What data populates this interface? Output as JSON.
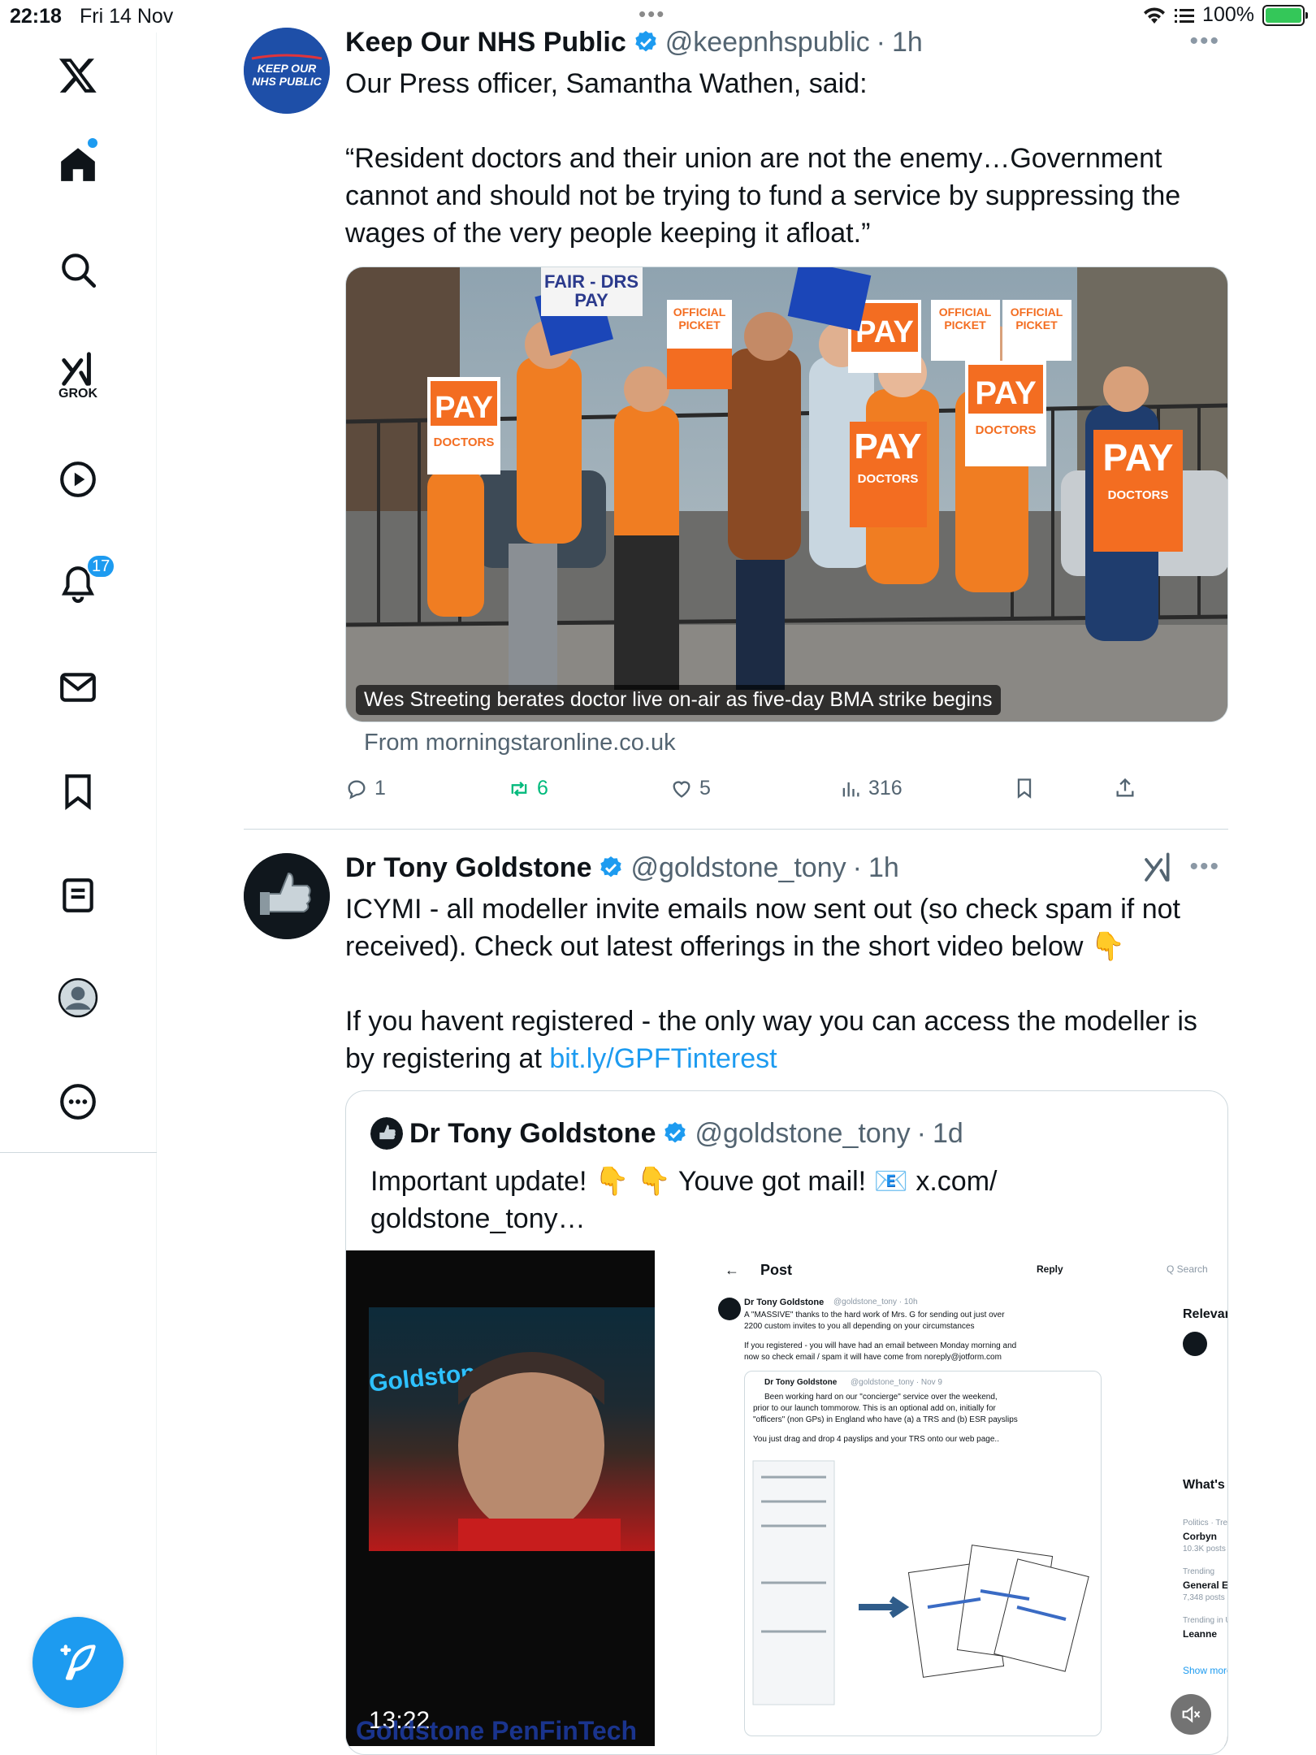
{
  "status_bar": {
    "time": "22:18",
    "date": "Fri 14 Nov",
    "battery": "100%"
  },
  "sidebar": {
    "grok_label": "GROK",
    "notifications_count": "17"
  },
  "posts": [
    {
      "avatar_text": "KEEP OUR NHS PUBLIC",
      "name": "Keep Our NHS Public",
      "handle": "@keepnhspublic",
      "sep": "·",
      "time": "1h",
      "text": "Our Press officer, Samantha Wathen, said:\n\n“Resident doctors and their union are not the enemy…Government cannot and should not be trying to fund a service by suppressing the wages of the very people keeping it afloat.”",
      "link_card": {
        "caption": "Wes Streeting berates doctor live on-air as five-day BMA strike begins",
        "from": "From morningstaronline.co.uk"
      },
      "actions": {
        "replies": "1",
        "reposts": "6",
        "likes": "5",
        "views": "316"
      }
    },
    {
      "name": "Dr Tony Goldstone",
      "handle": "@goldstone_tony",
      "sep": "·",
      "time": "1h",
      "text_part1": "ICYMI - all modeller invite emails now sent out (so check spam if not received). Check out latest offerings in the short video below 👇\n\nIf you havent registered - the only way you can access the modeller is by registering at ",
      "link": "bit.ly/GPFTinterest",
      "quote": {
        "name": "Dr Tony Goldstone",
        "handle": "@goldstone_tony",
        "sep": "·",
        "time": "1d",
        "text": "Important update! 👇 👇 Youve got mail! 📧 x.com/\ngoldstone_tony…",
        "video": {
          "duration": "13:22",
          "brand_text": "Goldstone PenFinTech",
          "neon_text": "Goldstone",
          "screen": {
            "back": "←",
            "title": "Post",
            "reply": "Reply",
            "search": "Q Search",
            "relevant": "Relevan",
            "whats": "What's h",
            "author": "Dr Tony Goldstone",
            "author_handle": "@goldstone_tony · 10h",
            "line1": "A \"MASSIVE\" thanks to the hard work of Mrs. G for sending out just over",
            "line2": "2200 custom invites to you all depending on your circumstances",
            "line3": "If you registered - you will have had an email between Monday morning and",
            "line4": "now so check email / spam it will have come from noreply@jotform.com",
            "inner_author": "Dr Tony Goldstone",
            "inner_handle": "@goldstone_tony · Nov 9",
            "inner1": "Been working hard on our \"concierge\" service over the weekend,",
            "inner2": "prior to our launch tommorow. This is an optional add on, initially for",
            "inner3": "\"officers\" (non GPs) in England who have (a) a TRS and (b) ESR payslips",
            "inner4": "You just drag and drop 4 payslips and your TRS onto our web page..",
            "trend1_cat": "Politics · Tren",
            "trend1": "Corbyn",
            "trend1_posts": "10.3K posts",
            "trend2_cat": "Trending",
            "trend2": "General Ele",
            "trend2_posts": "7,348 posts",
            "trend3_cat": "Trending in U",
            "trend3": "Leanne",
            "show_more": "Show more"
          }
        }
      }
    }
  ],
  "colors": {
    "accent": "#1d9bf0",
    "repost": "#00ba7c",
    "secondary_text": "#536471"
  }
}
